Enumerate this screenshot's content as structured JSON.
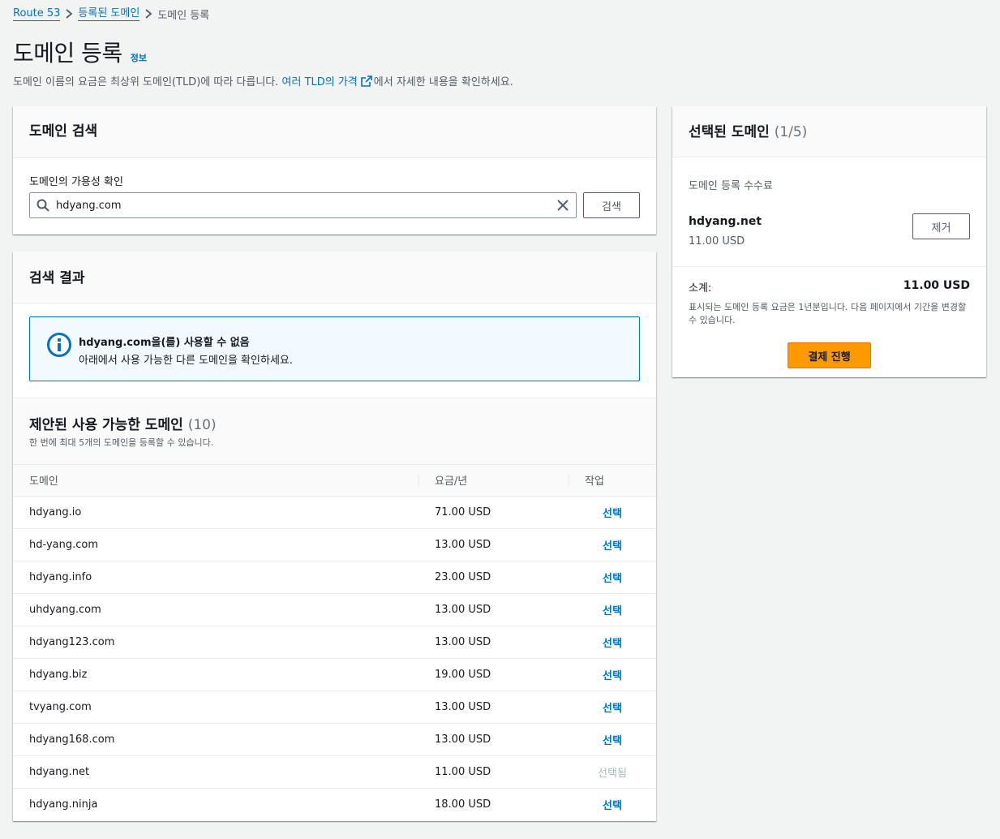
{
  "breadcrumb": {
    "root": "Route 53",
    "parent": "등록된 도메인",
    "current": "도메인 등록"
  },
  "page": {
    "title": "도메인 등록",
    "info_link": "정보",
    "subtitle_prefix": "도메인 이름의 요금은 최상위 도메인(TLD)에 따라 다릅니다. ",
    "subtitle_link": "여러 TLD의 가격",
    "subtitle_suffix": "에서 자세한 내용을 확인하세요."
  },
  "search": {
    "header": "도메인 검색",
    "label": "도메인의 가용성 확인",
    "value": "hdyang.com",
    "button": "검색"
  },
  "results": {
    "header": "검색 결과",
    "alert_title": "hdyang.com을(를) 사용할 수 없음",
    "alert_text": "아래에서 사용 가능한 다른 도메인을 확인하세요.",
    "suggested_title": "제안된 사용 가능한 도메인",
    "suggested_count": "(10)",
    "suggested_desc": "한 번에 최대 5개의 도메인을 등록할 수 있습니다.",
    "columns": {
      "domain": "도메인",
      "price": "요금/년",
      "action": "작업"
    },
    "rows": [
      {
        "domain": "hdyang.io",
        "price": "71.00 USD",
        "action": "선택",
        "selected": false
      },
      {
        "domain": "hd-yang.com",
        "price": "13.00 USD",
        "action": "선택",
        "selected": false
      },
      {
        "domain": "hdyang.info",
        "price": "23.00 USD",
        "action": "선택",
        "selected": false
      },
      {
        "domain": "uhdyang.com",
        "price": "13.00 USD",
        "action": "선택",
        "selected": false
      },
      {
        "domain": "hdyang123.com",
        "price": "13.00 USD",
        "action": "선택",
        "selected": false
      },
      {
        "domain": "hdyang.biz",
        "price": "19.00 USD",
        "action": "선택",
        "selected": false
      },
      {
        "domain": "tvyang.com",
        "price": "13.00 USD",
        "action": "선택",
        "selected": false
      },
      {
        "domain": "hdyang168.com",
        "price": "13.00 USD",
        "action": "선택",
        "selected": false
      },
      {
        "domain": "hdyang.net",
        "price": "11.00 USD",
        "action": "선택됨",
        "selected": true
      },
      {
        "domain": "hdyang.ninja",
        "price": "18.00 USD",
        "action": "선택",
        "selected": false
      }
    ]
  },
  "selected": {
    "header": "선택된 도메인",
    "count": "(1/5)",
    "fee_label": "도메인 등록 수수료",
    "item_name": "hdyang.net",
    "item_price": "11.00 USD",
    "remove_button": "제거",
    "subtotal_label": "소계:",
    "subtotal_value": "11.00 USD",
    "note": "표시되는 도메인 등록 요금은 1년분입니다. 다음 페이지에서 기간을 변경할 수 있습니다.",
    "checkout_button": "결제 진행"
  },
  "colors": {
    "link": "#0073bb",
    "primary_button": "#ff9900",
    "alert_bg": "#f1faff",
    "page_bg": "#f2f3f3"
  }
}
